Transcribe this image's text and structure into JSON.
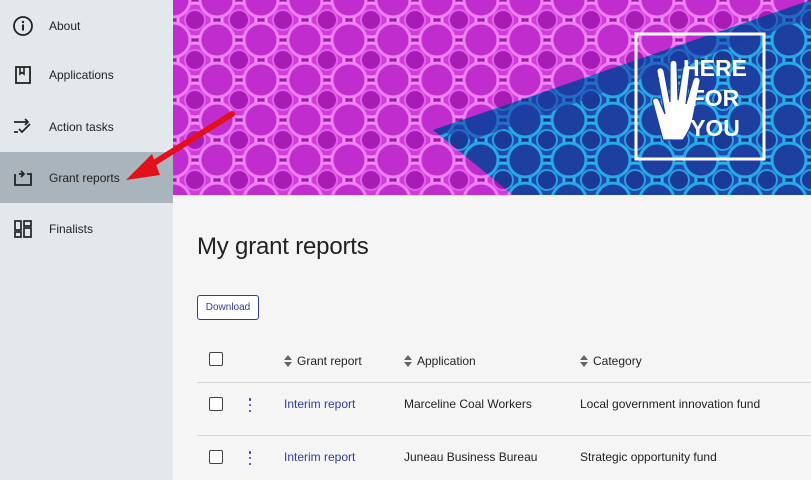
{
  "sidebar": {
    "items": [
      {
        "label": "About",
        "icon": "info-icon"
      },
      {
        "label": "Applications",
        "icon": "bookmark-icon"
      },
      {
        "label": "Action tasks",
        "icon": "tasks-icon"
      },
      {
        "label": "Grant reports",
        "icon": "report-icon",
        "active": true
      },
      {
        "label": "Finalists",
        "icon": "finalists-icon"
      }
    ]
  },
  "banner": {
    "badge_lines": [
      "HERE",
      "FOR",
      "YOU"
    ],
    "colors": {
      "pink": "#c020c8",
      "blue": "#1f3aa8",
      "cyan": "#1aa6e0"
    }
  },
  "main": {
    "title": "My grant reports",
    "download_label": "Download",
    "table": {
      "columns": [
        "Grant report",
        "Application",
        "Category"
      ],
      "rows": [
        {
          "report": "Interim report",
          "application": "Marceline Coal Workers",
          "category": "Local government innovation fund"
        },
        {
          "report": "Interim report",
          "application": "Juneau Business Bureau",
          "category": "Strategic opportunity fund"
        }
      ]
    }
  },
  "colors": {
    "accent": "#2e3b9e",
    "annotation_arrow": "#e3101a",
    "sidebar_bg": "#e3e8ec",
    "sidebar_active": "#a9b4bd"
  }
}
